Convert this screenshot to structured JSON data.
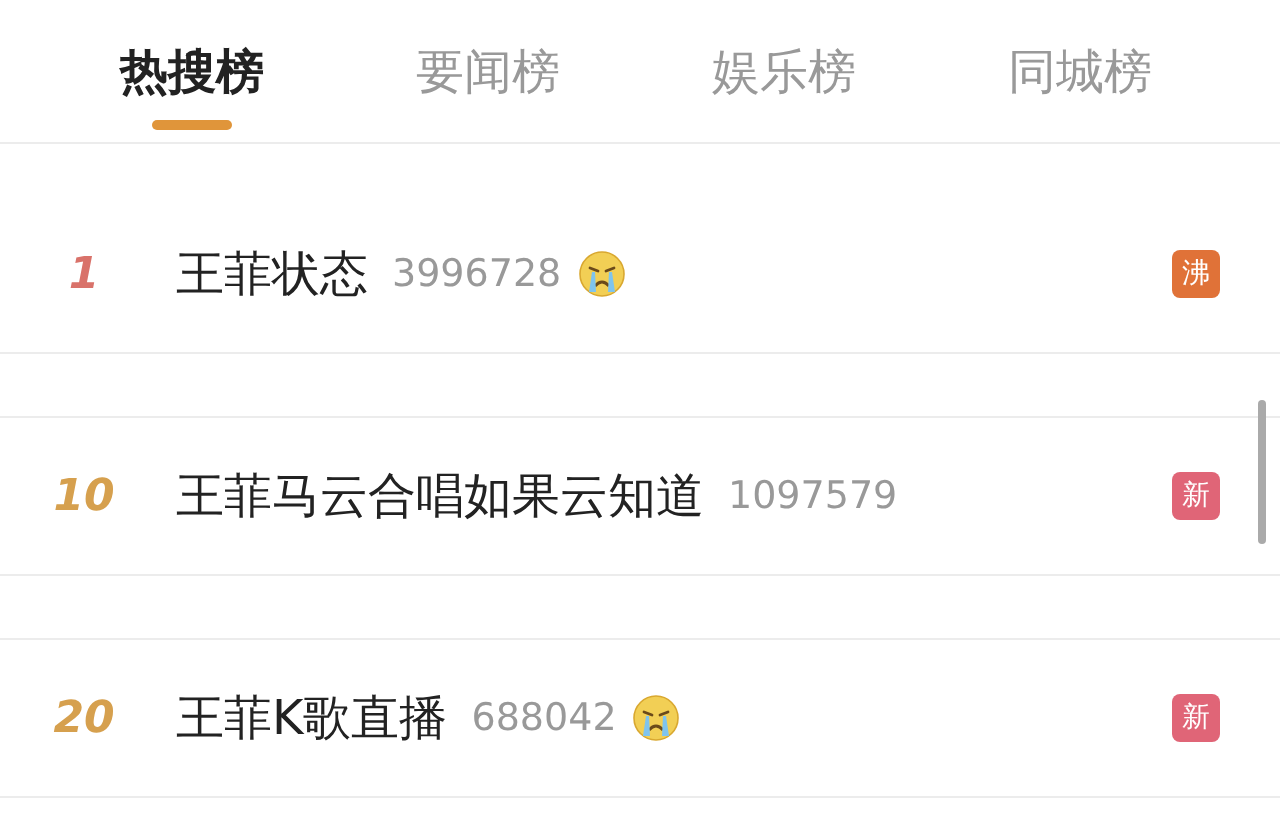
{
  "tabs": [
    {
      "label": "热搜榜",
      "selected": true
    },
    {
      "label": "要闻榜",
      "selected": false
    },
    {
      "label": "娱乐榜",
      "selected": false
    },
    {
      "label": "同城榜",
      "selected": false
    }
  ],
  "rows": [
    {
      "rank": {
        "text": "1",
        "color": "#d9726a"
      },
      "title": "王菲状态",
      "count": "3996728",
      "emoji": true,
      "badge": {
        "text": "沸",
        "color": "#e07238"
      }
    },
    {
      "rank": {
        "text": "10",
        "color": "#d6a04e"
      },
      "title": "王菲马云合唱如果云知道",
      "count": "1097579",
      "emoji": false,
      "badge": {
        "text": "新",
        "color": "#e06577"
      }
    },
    {
      "rank": {
        "text": "20",
        "color": "#d6a04e"
      },
      "title": "王菲K歌直播",
      "count": "688042",
      "emoji": true,
      "badge": {
        "text": "新",
        "color": "#e06577"
      }
    }
  ]
}
